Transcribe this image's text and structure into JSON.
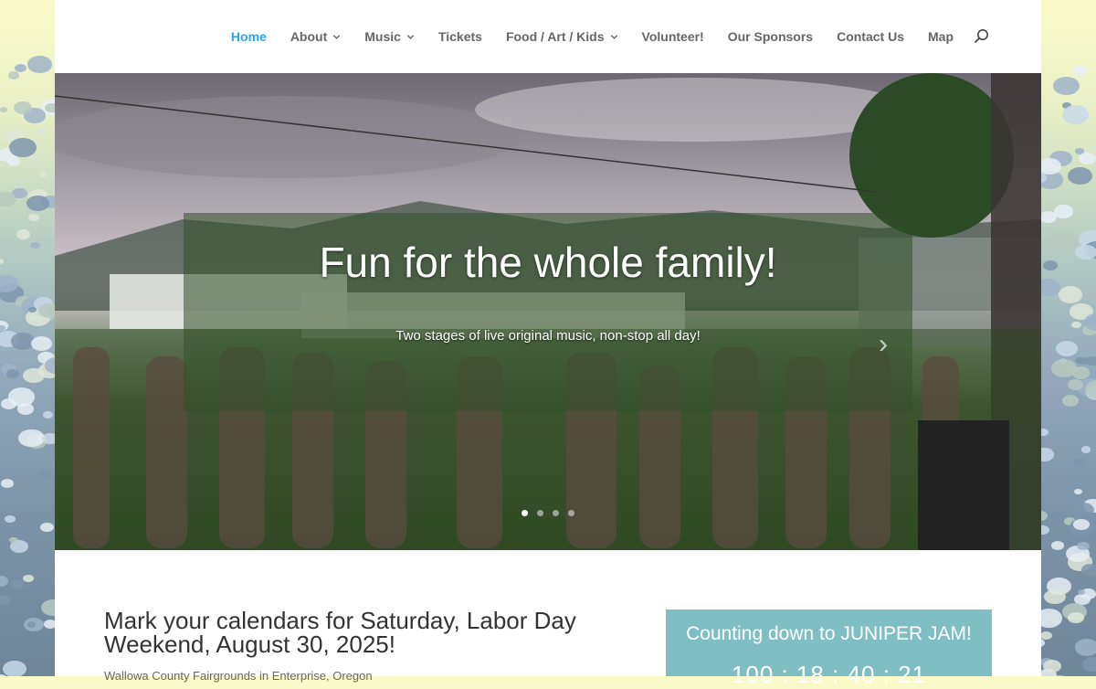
{
  "nav": {
    "items": [
      {
        "label": "Home",
        "active": true,
        "dropdown": false
      },
      {
        "label": "About",
        "active": false,
        "dropdown": true
      },
      {
        "label": "Music",
        "active": false,
        "dropdown": true
      },
      {
        "label": "Tickets",
        "active": false,
        "dropdown": false
      },
      {
        "label": "Food / Art / Kids",
        "active": false,
        "dropdown": true
      },
      {
        "label": "Volunteer!",
        "active": false,
        "dropdown": false
      },
      {
        "label": "Our Sponsors",
        "active": false,
        "dropdown": false
      },
      {
        "label": "Contact Us",
        "active": false,
        "dropdown": false
      },
      {
        "label": "Map",
        "active": false,
        "dropdown": false
      }
    ],
    "search_icon": "search-icon",
    "active_color": "#2ea3f2"
  },
  "hero": {
    "title": "Fun for the whole family!",
    "subtitle": "Two stages of live original music, non-stop all day!",
    "slides": 4,
    "current_slide": 1
  },
  "main": {
    "headline": "Mark your calendars for Saturday, Labor Day Weekend, August 30, 2025!",
    "location": "Wallowa County Fairgrounds in Enterprise, Oregon"
  },
  "countdown": {
    "title": "Counting down to JUNIPER JAM!",
    "days": "100",
    "hours": "18",
    "minutes": "40",
    "seconds": "21",
    "bg_color": "#7fbfc3"
  }
}
